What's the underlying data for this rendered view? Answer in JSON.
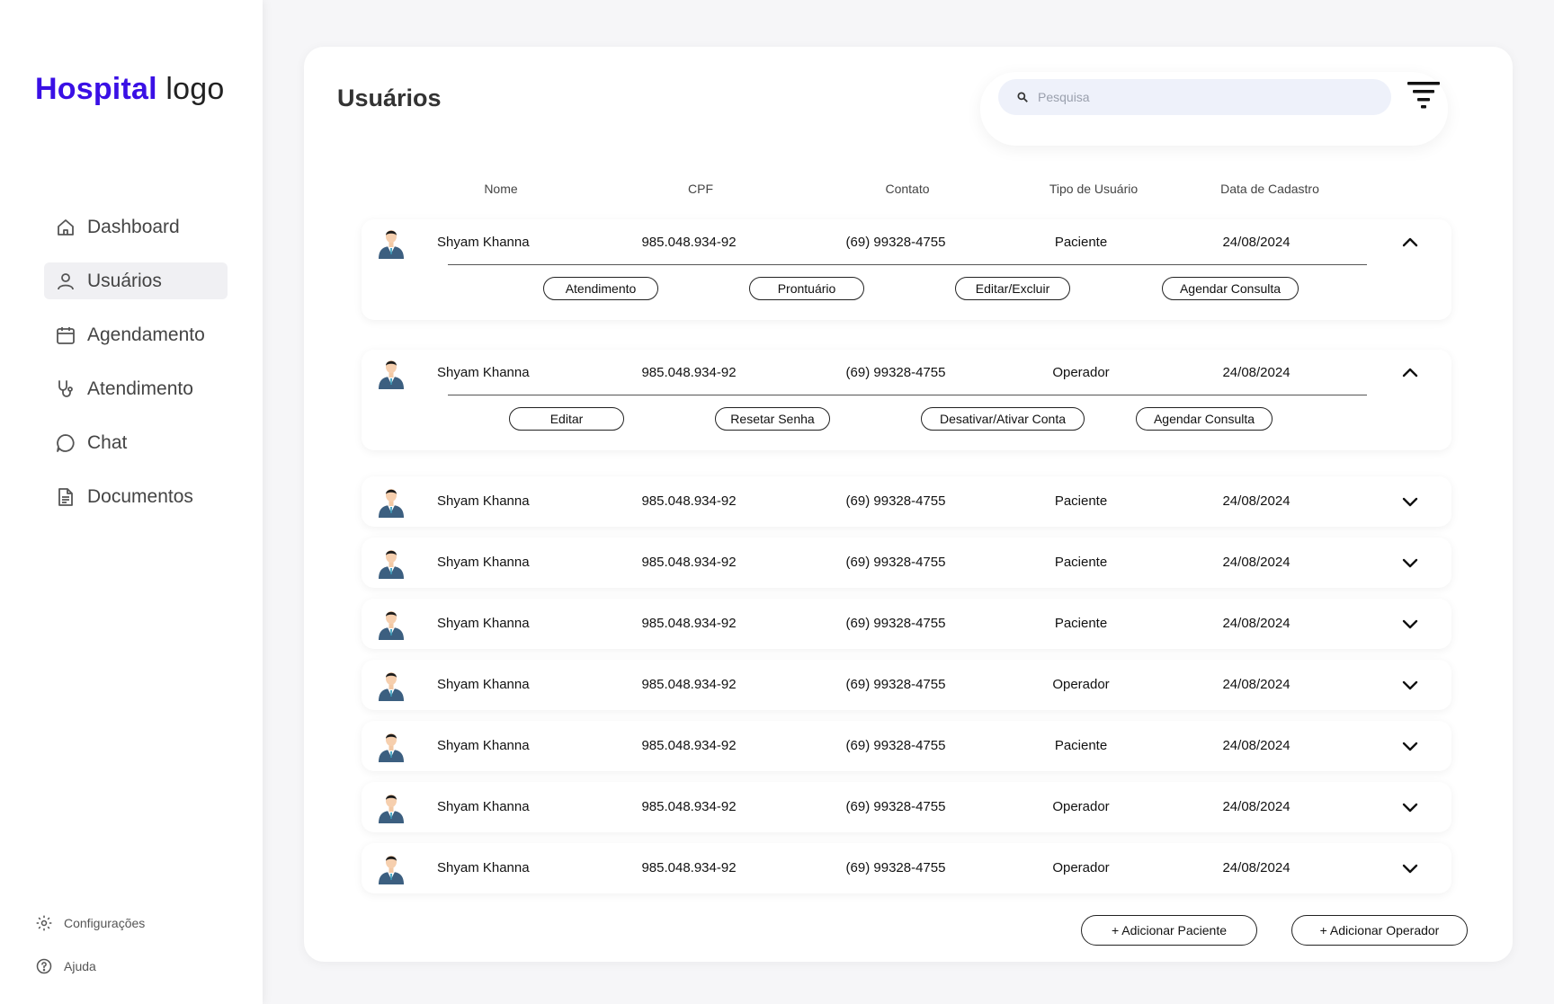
{
  "logo": {
    "brand": "Hospital",
    "rest": " logo"
  },
  "sidebar": {
    "items": [
      {
        "label": "Dashboard",
        "icon": "home-icon"
      },
      {
        "label": "Usuários",
        "icon": "user-icon",
        "active": true
      },
      {
        "label": "Agendamento",
        "icon": "calendar-icon"
      },
      {
        "label": "Atendimento",
        "icon": "stethoscope-icon"
      },
      {
        "label": "Chat",
        "icon": "chat-icon"
      },
      {
        "label": "Documentos",
        "icon": "document-icon"
      }
    ],
    "bottom": [
      {
        "label": "Configurações",
        "icon": "gear-icon"
      },
      {
        "label": "Ajuda",
        "icon": "help-icon"
      }
    ]
  },
  "main": {
    "title": "Usuários",
    "search": {
      "placeholder": "Pesquisa",
      "value": ""
    },
    "headers": [
      "Nome",
      "CPF",
      "Contato",
      "Tipo de Usuário",
      "Data de Cadastro"
    ],
    "rows": [
      {
        "nome": "Shyam Khanna",
        "cpf": "985.048.934-92",
        "contato": "(69) 99328-4755",
        "tipo": "Paciente",
        "data": "24/08/2024",
        "expanded": true,
        "actions": [
          "Atendimento",
          "Prontuário",
          "Editar/Excluir",
          "Agendar Consulta"
        ]
      },
      {
        "nome": "Shyam Khanna",
        "cpf": "985.048.934-92",
        "contato": "(69) 99328-4755",
        "tipo": "Operador",
        "data": "24/08/2024",
        "expanded": true,
        "actions": [
          "Editar",
          "Resetar Senha",
          "Desativar/Ativar Conta",
          "Agendar Consulta"
        ]
      },
      {
        "nome": "Shyam Khanna",
        "cpf": "985.048.934-92",
        "contato": "(69) 99328-4755",
        "tipo": "Paciente",
        "data": "24/08/2024",
        "expanded": false
      },
      {
        "nome": "Shyam Khanna",
        "cpf": "985.048.934-92",
        "contato": "(69) 99328-4755",
        "tipo": "Paciente",
        "data": "24/08/2024",
        "expanded": false
      },
      {
        "nome": "Shyam Khanna",
        "cpf": "985.048.934-92",
        "contato": "(69) 99328-4755",
        "tipo": "Paciente",
        "data": "24/08/2024",
        "expanded": false
      },
      {
        "nome": "Shyam Khanna",
        "cpf": "985.048.934-92",
        "contato": "(69) 99328-4755",
        "tipo": "Operador",
        "data": "24/08/2024",
        "expanded": false
      },
      {
        "nome": "Shyam Khanna",
        "cpf": "985.048.934-92",
        "contato": "(69) 99328-4755",
        "tipo": "Paciente",
        "data": "24/08/2024",
        "expanded": false
      },
      {
        "nome": "Shyam Khanna",
        "cpf": "985.048.934-92",
        "contato": "(69) 99328-4755",
        "tipo": "Operador",
        "data": "24/08/2024",
        "expanded": false
      },
      {
        "nome": "Shyam Khanna",
        "cpf": "985.048.934-92",
        "contato": "(69) 99328-4755",
        "tipo": "Operador",
        "data": "24/08/2024",
        "expanded": false
      }
    ],
    "buttons": {
      "add_patient": "+ Adicionar Paciente",
      "add_operator": "+ Adicionar Operador"
    }
  },
  "colors": {
    "brand": "#3a10e5",
    "search_bg": "#eef1fa",
    "active_nav": "#f0f0f3"
  }
}
